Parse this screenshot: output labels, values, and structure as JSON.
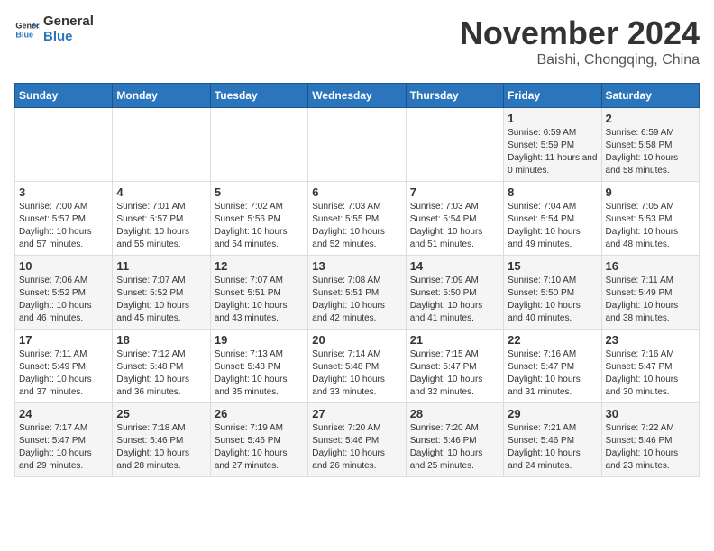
{
  "logo": {
    "line1": "General",
    "line2": "Blue"
  },
  "title": "November 2024",
  "location": "Baishi, Chongqing, China",
  "days_of_week": [
    "Sunday",
    "Monday",
    "Tuesday",
    "Wednesday",
    "Thursday",
    "Friday",
    "Saturday"
  ],
  "weeks": [
    [
      {
        "day": "",
        "info": ""
      },
      {
        "day": "",
        "info": ""
      },
      {
        "day": "",
        "info": ""
      },
      {
        "day": "",
        "info": ""
      },
      {
        "day": "",
        "info": ""
      },
      {
        "day": "1",
        "info": "Sunrise: 6:59 AM\nSunset: 5:59 PM\nDaylight: 11 hours and 0 minutes."
      },
      {
        "day": "2",
        "info": "Sunrise: 6:59 AM\nSunset: 5:58 PM\nDaylight: 10 hours and 58 minutes."
      }
    ],
    [
      {
        "day": "3",
        "info": "Sunrise: 7:00 AM\nSunset: 5:57 PM\nDaylight: 10 hours and 57 minutes."
      },
      {
        "day": "4",
        "info": "Sunrise: 7:01 AM\nSunset: 5:57 PM\nDaylight: 10 hours and 55 minutes."
      },
      {
        "day": "5",
        "info": "Sunrise: 7:02 AM\nSunset: 5:56 PM\nDaylight: 10 hours and 54 minutes."
      },
      {
        "day": "6",
        "info": "Sunrise: 7:03 AM\nSunset: 5:55 PM\nDaylight: 10 hours and 52 minutes."
      },
      {
        "day": "7",
        "info": "Sunrise: 7:03 AM\nSunset: 5:54 PM\nDaylight: 10 hours and 51 minutes."
      },
      {
        "day": "8",
        "info": "Sunrise: 7:04 AM\nSunset: 5:54 PM\nDaylight: 10 hours and 49 minutes."
      },
      {
        "day": "9",
        "info": "Sunrise: 7:05 AM\nSunset: 5:53 PM\nDaylight: 10 hours and 48 minutes."
      }
    ],
    [
      {
        "day": "10",
        "info": "Sunrise: 7:06 AM\nSunset: 5:52 PM\nDaylight: 10 hours and 46 minutes."
      },
      {
        "day": "11",
        "info": "Sunrise: 7:07 AM\nSunset: 5:52 PM\nDaylight: 10 hours and 45 minutes."
      },
      {
        "day": "12",
        "info": "Sunrise: 7:07 AM\nSunset: 5:51 PM\nDaylight: 10 hours and 43 minutes."
      },
      {
        "day": "13",
        "info": "Sunrise: 7:08 AM\nSunset: 5:51 PM\nDaylight: 10 hours and 42 minutes."
      },
      {
        "day": "14",
        "info": "Sunrise: 7:09 AM\nSunset: 5:50 PM\nDaylight: 10 hours and 41 minutes."
      },
      {
        "day": "15",
        "info": "Sunrise: 7:10 AM\nSunset: 5:50 PM\nDaylight: 10 hours and 40 minutes."
      },
      {
        "day": "16",
        "info": "Sunrise: 7:11 AM\nSunset: 5:49 PM\nDaylight: 10 hours and 38 minutes."
      }
    ],
    [
      {
        "day": "17",
        "info": "Sunrise: 7:11 AM\nSunset: 5:49 PM\nDaylight: 10 hours and 37 minutes."
      },
      {
        "day": "18",
        "info": "Sunrise: 7:12 AM\nSunset: 5:48 PM\nDaylight: 10 hours and 36 minutes."
      },
      {
        "day": "19",
        "info": "Sunrise: 7:13 AM\nSunset: 5:48 PM\nDaylight: 10 hours and 35 minutes."
      },
      {
        "day": "20",
        "info": "Sunrise: 7:14 AM\nSunset: 5:48 PM\nDaylight: 10 hours and 33 minutes."
      },
      {
        "day": "21",
        "info": "Sunrise: 7:15 AM\nSunset: 5:47 PM\nDaylight: 10 hours and 32 minutes."
      },
      {
        "day": "22",
        "info": "Sunrise: 7:16 AM\nSunset: 5:47 PM\nDaylight: 10 hours and 31 minutes."
      },
      {
        "day": "23",
        "info": "Sunrise: 7:16 AM\nSunset: 5:47 PM\nDaylight: 10 hours and 30 minutes."
      }
    ],
    [
      {
        "day": "24",
        "info": "Sunrise: 7:17 AM\nSunset: 5:47 PM\nDaylight: 10 hours and 29 minutes."
      },
      {
        "day": "25",
        "info": "Sunrise: 7:18 AM\nSunset: 5:46 PM\nDaylight: 10 hours and 28 minutes."
      },
      {
        "day": "26",
        "info": "Sunrise: 7:19 AM\nSunset: 5:46 PM\nDaylight: 10 hours and 27 minutes."
      },
      {
        "day": "27",
        "info": "Sunrise: 7:20 AM\nSunset: 5:46 PM\nDaylight: 10 hours and 26 minutes."
      },
      {
        "day": "28",
        "info": "Sunrise: 7:20 AM\nSunset: 5:46 PM\nDaylight: 10 hours and 25 minutes."
      },
      {
        "day": "29",
        "info": "Sunrise: 7:21 AM\nSunset: 5:46 PM\nDaylight: 10 hours and 24 minutes."
      },
      {
        "day": "30",
        "info": "Sunrise: 7:22 AM\nSunset: 5:46 PM\nDaylight: 10 hours and 23 minutes."
      }
    ]
  ]
}
